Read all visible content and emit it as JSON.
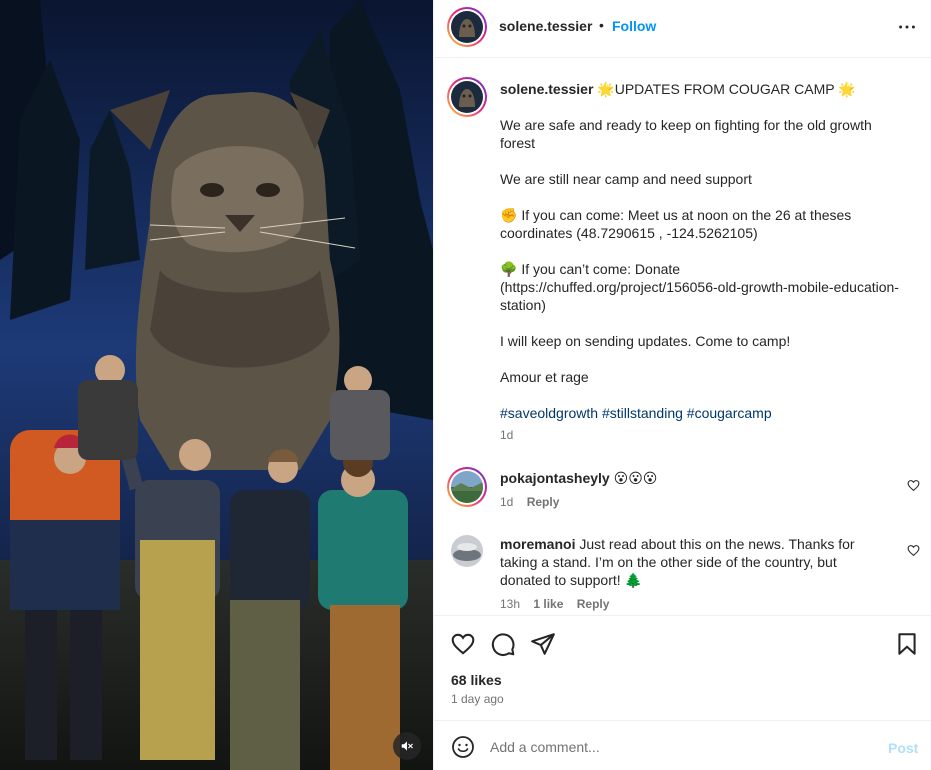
{
  "header": {
    "username": "solene.tessier",
    "separator": "•",
    "follow_label": "Follow",
    "more_icon": "more-horizontal-icon"
  },
  "caption": {
    "username": "solene.tessier",
    "title": "🌟UPDATES FROM COUGAR CAMP 🌟",
    "lines": [
      "We are safe and ready to keep on fighting for the old growth forest",
      "We are still near camp and need support",
      "✊ If you can come: Meet us at noon on the 26 at theses coordinates (48.7290615 , -124.5262105)",
      "🌳 If you can’t come: Donate (https://chuffed.org/project/156056-old-growth-mobile-education-station)",
      "I will keep on sending updates. Come to camp!",
      "Amour et rage"
    ],
    "hashtags": [
      "#saveoldgrowth",
      "#stillstanding",
      "#cougarcamp"
    ],
    "time": "1d"
  },
  "comments": [
    {
      "username": "pokajontasheyly",
      "text": "😮😮😮",
      "time": "1d",
      "likes": "",
      "reply_label": "Reply"
    },
    {
      "username": "moremanoi",
      "text": "Just read about this on the news. Thanks for taking a stand. I’m on the other side of the country, but donated to support! 🌲",
      "time": "13h",
      "likes": "1 like",
      "reply_label": "Reply"
    }
  ],
  "actions": {
    "likes": "68 likes",
    "posted_ago": "1 day ago"
  },
  "composer": {
    "placeholder": "Add a comment...",
    "post_label": "Post"
  },
  "colors": {
    "link_blue": "#0095f6",
    "hashtag": "#00376b",
    "post_disabled": "#b2dffc"
  }
}
